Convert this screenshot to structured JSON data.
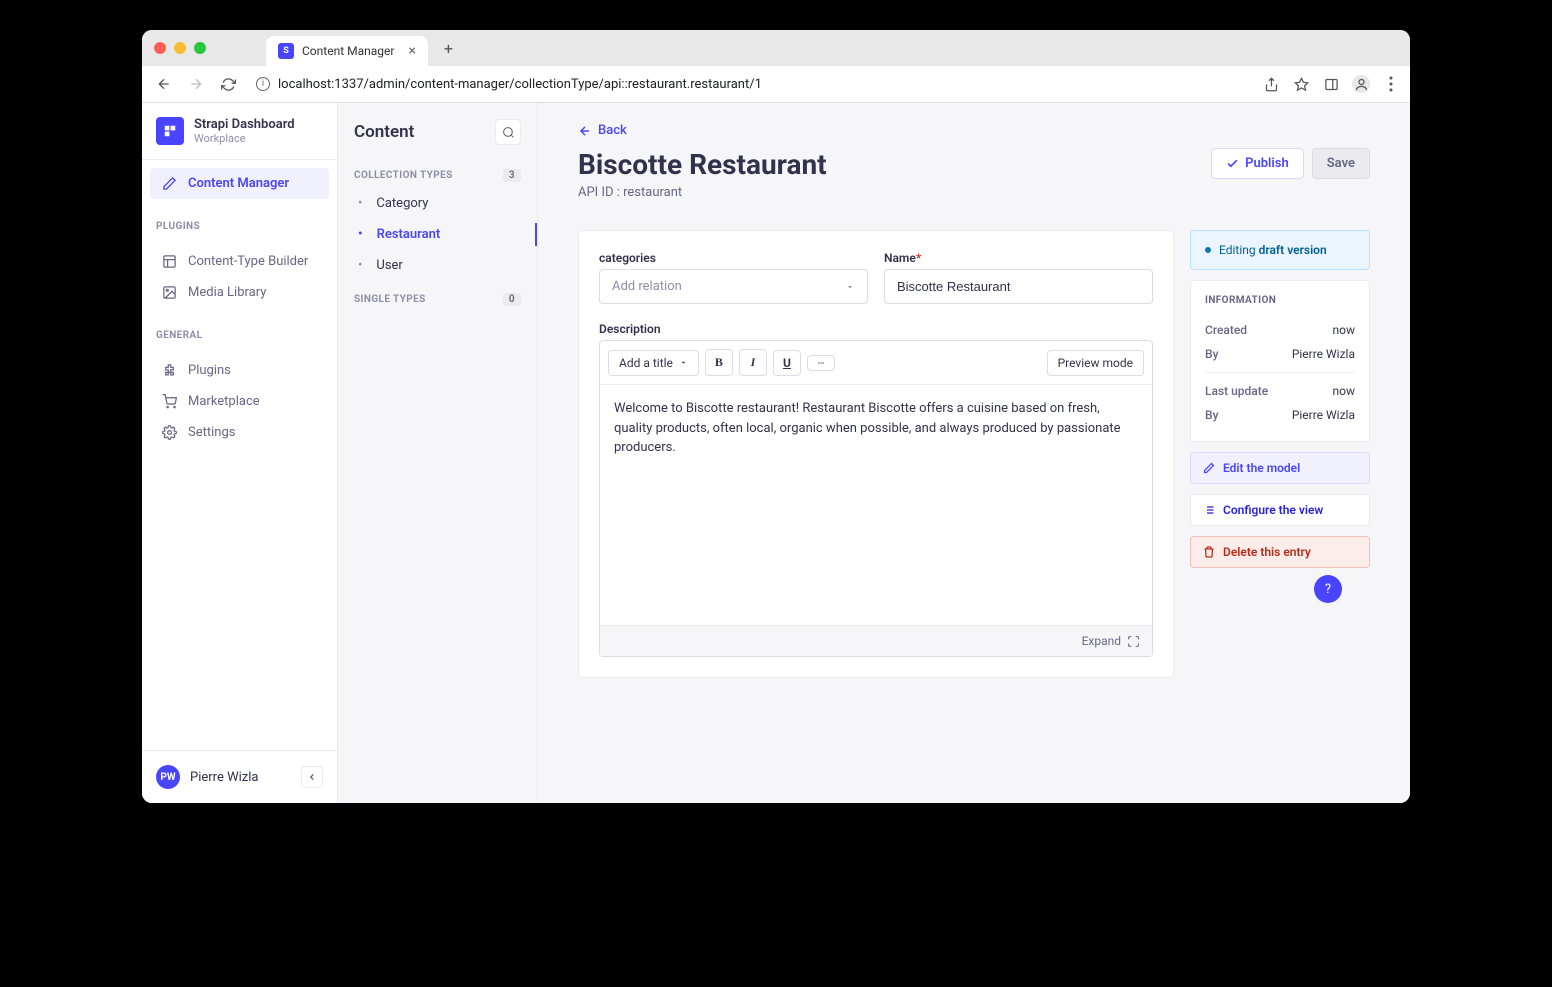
{
  "browser": {
    "tab_title": "Content Manager",
    "url": "localhost:1337/admin/content-manager/collectionType/api::restaurant.restaurant/1"
  },
  "brand": {
    "title": "Strapi Dashboard",
    "subtitle": "Workplace"
  },
  "nav": {
    "content_manager": "Content Manager",
    "plugins_header": "PLUGINS",
    "content_type_builder": "Content-Type Builder",
    "media_library": "Media Library",
    "general_header": "GENERAL",
    "plugins": "Plugins",
    "marketplace": "Marketplace",
    "settings": "Settings"
  },
  "user": {
    "initials": "PW",
    "name": "Pierre Wizla"
  },
  "panel2": {
    "title": "Content",
    "collection_types_label": "COLLECTION TYPES",
    "collection_types_count": "3",
    "items": [
      {
        "label": "Category",
        "active": false
      },
      {
        "label": "Restaurant",
        "active": true
      },
      {
        "label": "User",
        "active": false
      }
    ],
    "single_types_label": "SINGLE TYPES",
    "single_types_count": "0"
  },
  "main": {
    "back": "Back",
    "title": "Biscotte Restaurant",
    "api_id": "API ID : restaurant",
    "publish": "Publish",
    "save": "Save",
    "fields": {
      "categories_label": "categories",
      "categories_placeholder": "Add relation",
      "name_label": "Name",
      "name_value": "Biscotte Restaurant",
      "description_label": "Description",
      "description_value": "Welcome to Biscotte restaurant! Restaurant Biscotte offers a cuisine based on fresh, quality products, often local, organic when possible, and always produced by passionate producers."
    },
    "editor": {
      "add_title": "Add a title",
      "preview_mode": "Preview mode",
      "expand": "Expand"
    }
  },
  "sidebar3": {
    "status_prefix": "Editing ",
    "status_strong": "draft version",
    "info_header": "INFORMATION",
    "created_label": "Created",
    "created_value": "now",
    "created_by_label": "By",
    "created_by_value": "Pierre Wizla",
    "updated_label": "Last update",
    "updated_value": "now",
    "updated_by_label": "By",
    "updated_by_value": "Pierre Wizla",
    "edit_model": "Edit the model",
    "configure_view": "Configure the view",
    "delete_entry": "Delete this entry"
  }
}
